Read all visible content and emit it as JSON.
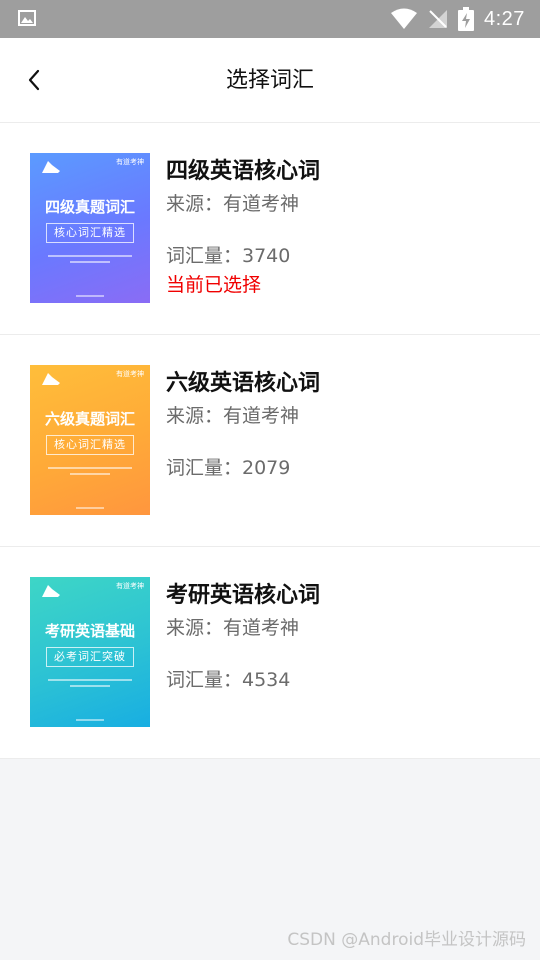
{
  "status_bar": {
    "time": "4:27",
    "icons": [
      "image-icon",
      "wifi-icon",
      "signal-off-icon",
      "battery-charging-icon"
    ]
  },
  "header": {
    "title": "选择词汇",
    "back_icon": "chevron-left-icon"
  },
  "books": [
    {
      "name": "四级英语核心词",
      "source": "来源：有道考神",
      "count": "词汇量：3740",
      "selected_label": "当前已选择",
      "is_selected": true,
      "cover": {
        "title": "四级真题词汇",
        "subtitle": "核心词汇精选",
        "colors": [
          "#5b8cff",
          "#7a5cf0"
        ]
      }
    },
    {
      "name": "六级英语核心词",
      "source": "来源：有道考神",
      "count": "词汇量：2079",
      "selected_label": "",
      "is_selected": false,
      "cover": {
        "title": "六级真题词汇",
        "subtitle": "核心词汇精选",
        "colors": [
          "#ffb833",
          "#ff9a3c"
        ]
      }
    },
    {
      "name": "考研英语核心词",
      "source": "来源：有道考神",
      "count": "词汇量：4534",
      "selected_label": "",
      "is_selected": false,
      "cover": {
        "title": "考研英语基础",
        "subtitle": "必考词汇突破",
        "colors": [
          "#3ad0c8",
          "#1ab0e0"
        ]
      }
    }
  ],
  "watermark": "CSDN @Android毕业设计源码",
  "colors": {
    "selected": "#f00000",
    "status_bar": "#9e9e9e",
    "background": "#f4f5f7"
  }
}
